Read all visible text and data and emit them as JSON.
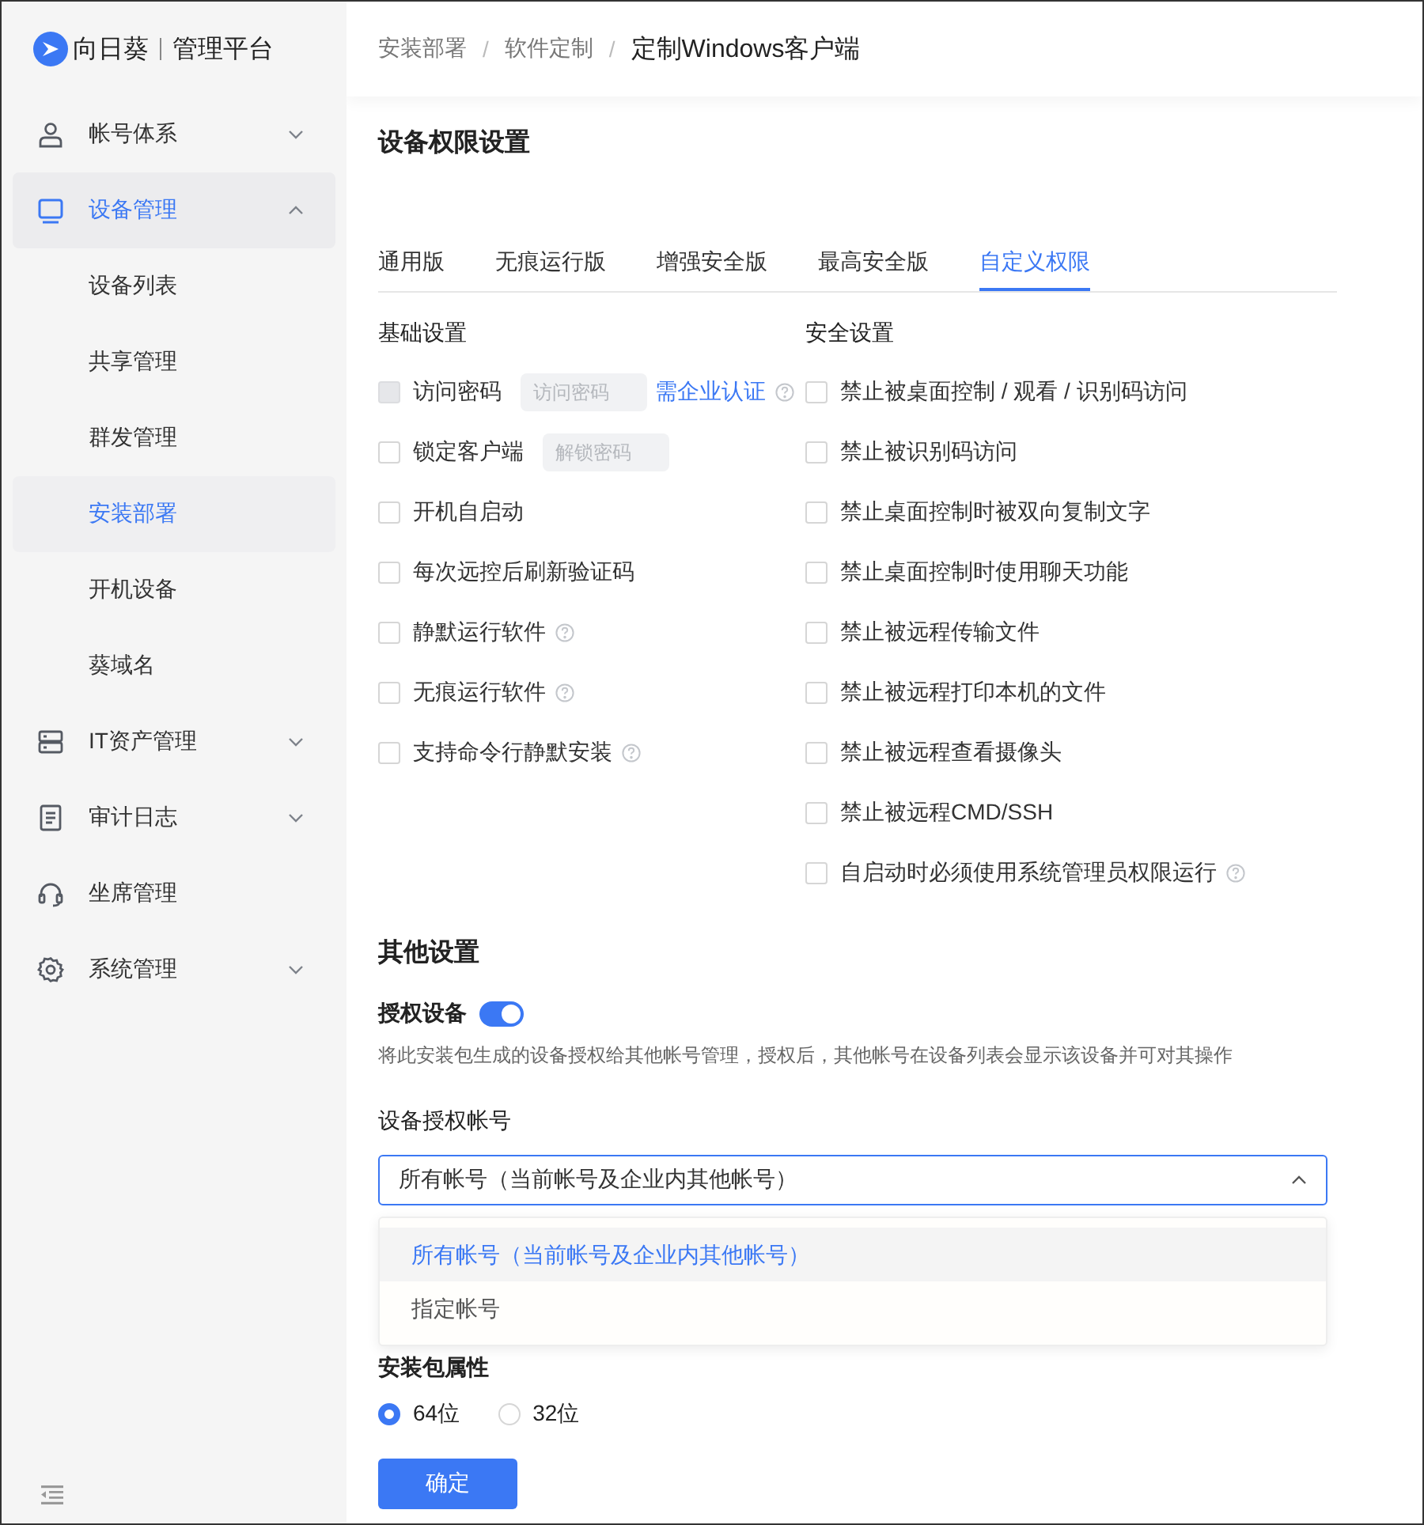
{
  "brand": {
    "name": "向日葵",
    "product": "管理平台"
  },
  "sidebar": {
    "items": [
      {
        "label": "帐号体系",
        "selected": false,
        "expanded": false
      },
      {
        "label": "设备管理",
        "selected": true,
        "expanded": true,
        "children": [
          {
            "label": "设备列表",
            "selected": false
          },
          {
            "label": "共享管理",
            "selected": false
          },
          {
            "label": "群发管理",
            "selected": false
          },
          {
            "label": "安装部署",
            "selected": true
          },
          {
            "label": "开机设备",
            "selected": false
          },
          {
            "label": "葵域名",
            "selected": false
          }
        ]
      },
      {
        "label": "IT资产管理",
        "selected": false,
        "expanded": false
      },
      {
        "label": "审计日志",
        "selected": false,
        "expanded": false
      },
      {
        "label": "坐席管理",
        "selected": false
      },
      {
        "label": "系统管理",
        "selected": false,
        "expanded": false
      }
    ]
  },
  "breadcrumb": [
    {
      "label": "安装部署"
    },
    {
      "separator": "/",
      "label": "软件定制"
    },
    {
      "separator": "/",
      "label": "定制Windows客户端"
    }
  ],
  "title": "设备权限设置",
  "tabs": [
    {
      "label": "通用版",
      "selected": false
    },
    {
      "label": "无痕运行版",
      "selected": false
    },
    {
      "label": "增强安全版",
      "selected": false
    },
    {
      "label": "最高安全版",
      "selected": false
    },
    {
      "label": "自定义权限",
      "selected": true
    }
  ],
  "basic": {
    "heading": "基础设置",
    "options": [
      {
        "label": "访问密码",
        "checked": false,
        "disabled": true,
        "field": {
          "placeholder": "访问密码"
        },
        "link": "需企业认证",
        "help": true
      },
      {
        "label": "锁定客户端",
        "checked": false,
        "disabled": false,
        "field": {
          "placeholder": "解锁密码"
        },
        "help": false
      },
      {
        "label": "开机自启动",
        "checked": false,
        "disabled": false,
        "help": false
      },
      {
        "label": "每次远控后刷新验证码",
        "checked": false,
        "disabled": false,
        "help": false
      },
      {
        "label": "静默运行软件",
        "checked": false,
        "disabled": false,
        "help": true
      },
      {
        "label": "无痕运行软件",
        "checked": false,
        "disabled": false,
        "help": true
      },
      {
        "label": "支持命令行静默安装",
        "checked": false,
        "disabled": false,
        "help": true
      }
    ]
  },
  "security": {
    "heading": "安全设置",
    "options": [
      {
        "label": "禁止被桌面控制 / 观看 / 识别码访问",
        "checked": false,
        "help": false
      },
      {
        "label": "禁止被识别码访问",
        "checked": false,
        "help": false
      },
      {
        "label": "禁止桌面控制时被双向复制文字",
        "checked": false,
        "help": false
      },
      {
        "label": "禁止桌面控制时使用聊天功能",
        "checked": false,
        "help": false
      },
      {
        "label": "禁止被远程传输文件",
        "checked": false,
        "help": false
      },
      {
        "label": "禁止被远程打印本机的文件",
        "checked": false,
        "help": false
      },
      {
        "label": "禁止被远程查看摄像头",
        "checked": false,
        "help": false
      },
      {
        "label": "禁止被远程CMD/SSH",
        "checked": false,
        "help": false
      },
      {
        "label": "自启动时必须使用系统管理员权限运行",
        "checked": false,
        "help": true
      }
    ]
  },
  "other": {
    "heading": "其他设置",
    "authorize": {
      "label": "授权设备",
      "on": true,
      "description": "将此安装包生成的设备授权给其他帐号管理，授权后，其他帐号在设备列表会显示该设备并可对其操作"
    },
    "account": {
      "label": "设备授权帐号",
      "value": "所有帐号（当前帐号及企业内其他帐号）",
      "expanded": true,
      "options": [
        {
          "label": "所有帐号（当前帐号及企业内其他帐号）",
          "selected": true
        },
        {
          "label": "指定帐号",
          "selected": false
        }
      ]
    },
    "package": {
      "label": "安装包属性",
      "options": [
        {
          "label": "64位",
          "selected": true
        },
        {
          "label": "32位",
          "selected": false
        }
      ]
    }
  },
  "confirm": "确定"
}
